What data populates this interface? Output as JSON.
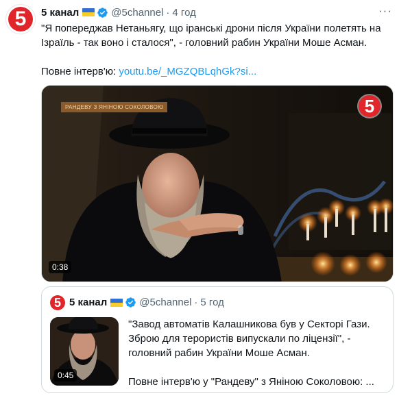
{
  "tweet": {
    "author_name": "5 канал",
    "handle": "@5channel",
    "separator": "·",
    "time": "4 год",
    "more_icon": "more-dots-icon",
    "text_main": "\"Я попереджав Нетаньягу, що іранські дрони після України полетять на Ізраїль - так воно і сталося\", - головний рабин України Моше Асман.",
    "text_link_prefix": "Повне інтерв'ю: ",
    "link": "youtu.be/_MGZQBLqhGk?si...",
    "logo_digit": "5",
    "colors": {
      "link": "#1d9bf0",
      "brand_red": "#e0262b",
      "muted": "#536471",
      "verified": "#1d9bf0"
    }
  },
  "video": {
    "duration": "0:38",
    "channel_logo_digit": "5",
    "show_tag": "РАНДЕВУ З ЯНІНОЮ СОКОЛОВОЮ"
  },
  "quote": {
    "author_name": "5 канал",
    "handle": "@5channel",
    "separator": "·",
    "time": "5 год",
    "logo_digit": "5",
    "text_main": "\"Завод автоматів Калашникова був у Секторі Гази. Зброю для терористів випускали по ліцензії\", - головний рабин України Моше Асман.",
    "text_tail": "Повне інтерв'ю у \"Рандеву\" з Яніною Соколовою: ...",
    "thumb_duration": "0:45"
  }
}
